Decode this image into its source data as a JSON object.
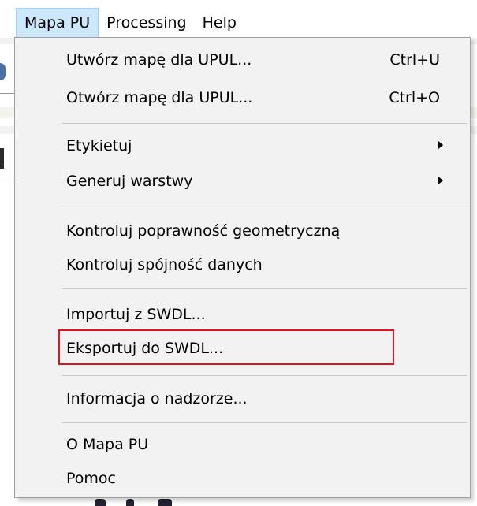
{
  "menubar": {
    "items": [
      {
        "label": "Mapa PU",
        "active": true
      },
      {
        "label": "Processing",
        "active": false
      },
      {
        "label": "Help",
        "active": false
      }
    ]
  },
  "menu": {
    "create_map": {
      "label": "Utwórz mapę dla UPUL...",
      "shortcut": "Ctrl+U"
    },
    "open_map": {
      "label": "Otwórz mapę dla UPUL...",
      "shortcut": "Ctrl+O"
    },
    "label": {
      "label": "Etykietuj"
    },
    "generate_layers": {
      "label": "Generuj warstwy"
    },
    "check_geometry": {
      "label": "Kontroluj poprawność geometryczną"
    },
    "check_consistency": {
      "label": "Kontroluj spójność danych"
    },
    "import_swdl": {
      "label": "Importuj z SWDL..."
    },
    "export_swdl": {
      "label": "Eksportuj do SWDL..."
    },
    "supervision_info": {
      "label": "Informacja o nadzorze..."
    },
    "about": {
      "label": "O Mapa PU"
    },
    "help": {
      "label": "Pomoc"
    }
  },
  "colors": {
    "menubar_active_bg": "#cce8ff",
    "menu_bg": "#f2f2f2",
    "highlight_border": "#e0141e"
  }
}
